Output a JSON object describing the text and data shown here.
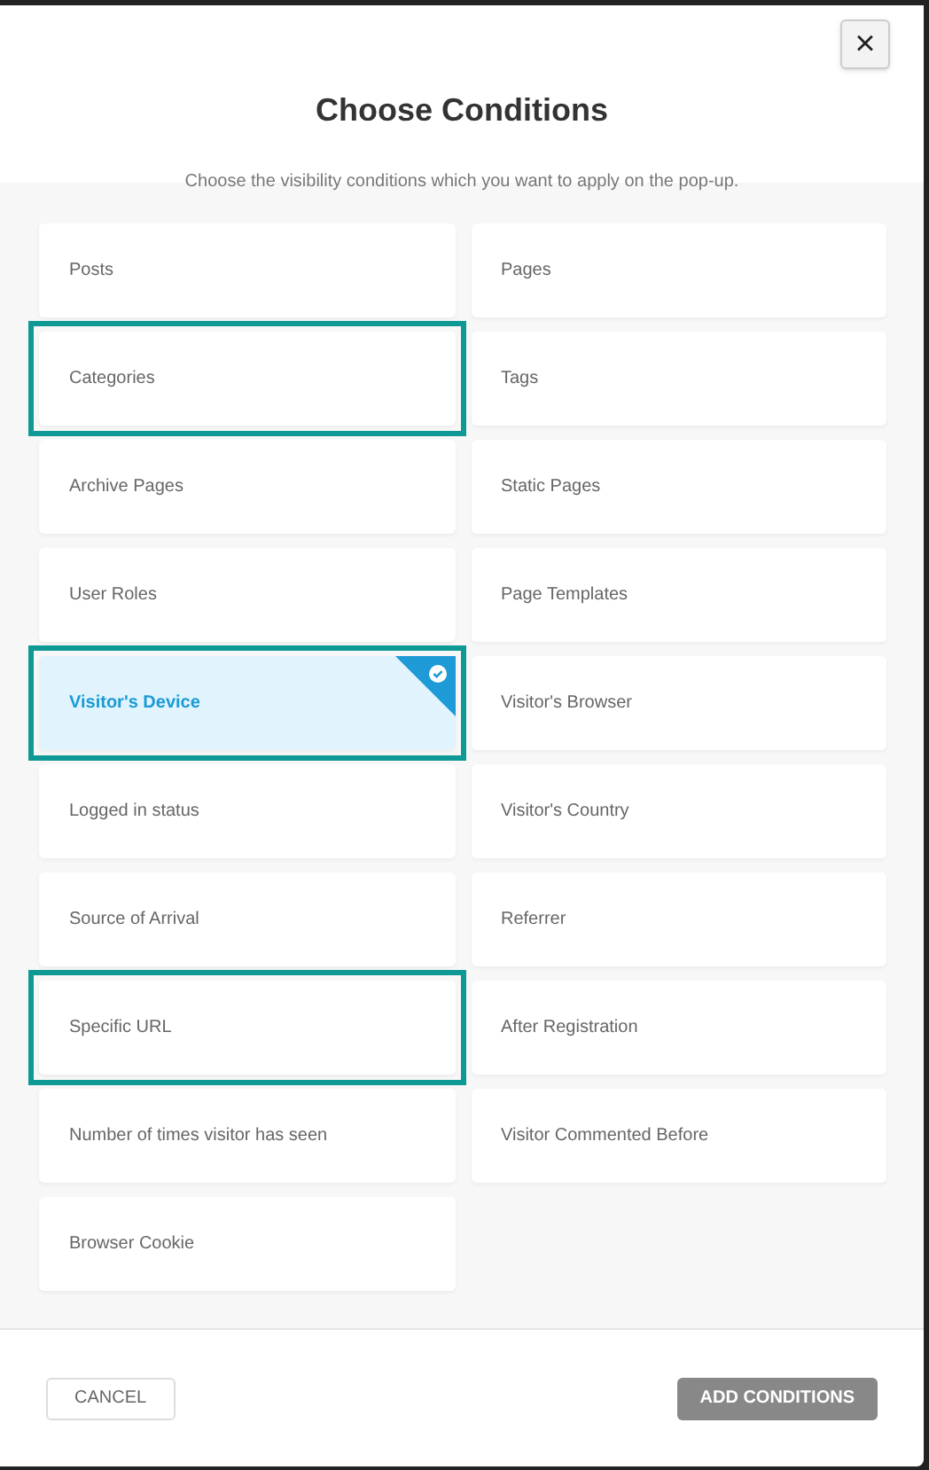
{
  "dialog": {
    "title": "Choose Conditions",
    "subtitle": "Choose the visibility conditions which you want to apply on the pop-up.",
    "close_label": "×"
  },
  "conditions": [
    {
      "label": "Posts",
      "selected": false,
      "highlighted": false
    },
    {
      "label": "Pages",
      "selected": false,
      "highlighted": false
    },
    {
      "label": "Categories",
      "selected": false,
      "highlighted": true
    },
    {
      "label": "Tags",
      "selected": false,
      "highlighted": false
    },
    {
      "label": "Archive Pages",
      "selected": false,
      "highlighted": false
    },
    {
      "label": "Static Pages",
      "selected": false,
      "highlighted": false
    },
    {
      "label": "User Roles",
      "selected": false,
      "highlighted": false
    },
    {
      "label": "Page Templates",
      "selected": false,
      "highlighted": false
    },
    {
      "label": "Visitor's Device",
      "selected": true,
      "highlighted": true
    },
    {
      "label": "Visitor's Browser",
      "selected": false,
      "highlighted": false
    },
    {
      "label": "Logged in status",
      "selected": false,
      "highlighted": false
    },
    {
      "label": "Visitor's Country",
      "selected": false,
      "highlighted": false
    },
    {
      "label": "Source of Arrival",
      "selected": false,
      "highlighted": false
    },
    {
      "label": "Referrer",
      "selected": false,
      "highlighted": false
    },
    {
      "label": "Specific URL",
      "selected": false,
      "highlighted": true
    },
    {
      "label": "After Registration",
      "selected": false,
      "highlighted": false
    },
    {
      "label": "Number of times visitor has seen",
      "selected": false,
      "highlighted": false
    },
    {
      "label": "Visitor Commented Before",
      "selected": false,
      "highlighted": false
    },
    {
      "label": "Browser Cookie",
      "selected": false,
      "highlighted": false
    }
  ],
  "footer": {
    "cancel": "CANCEL",
    "submit": "ADD CONDITIONS"
  }
}
